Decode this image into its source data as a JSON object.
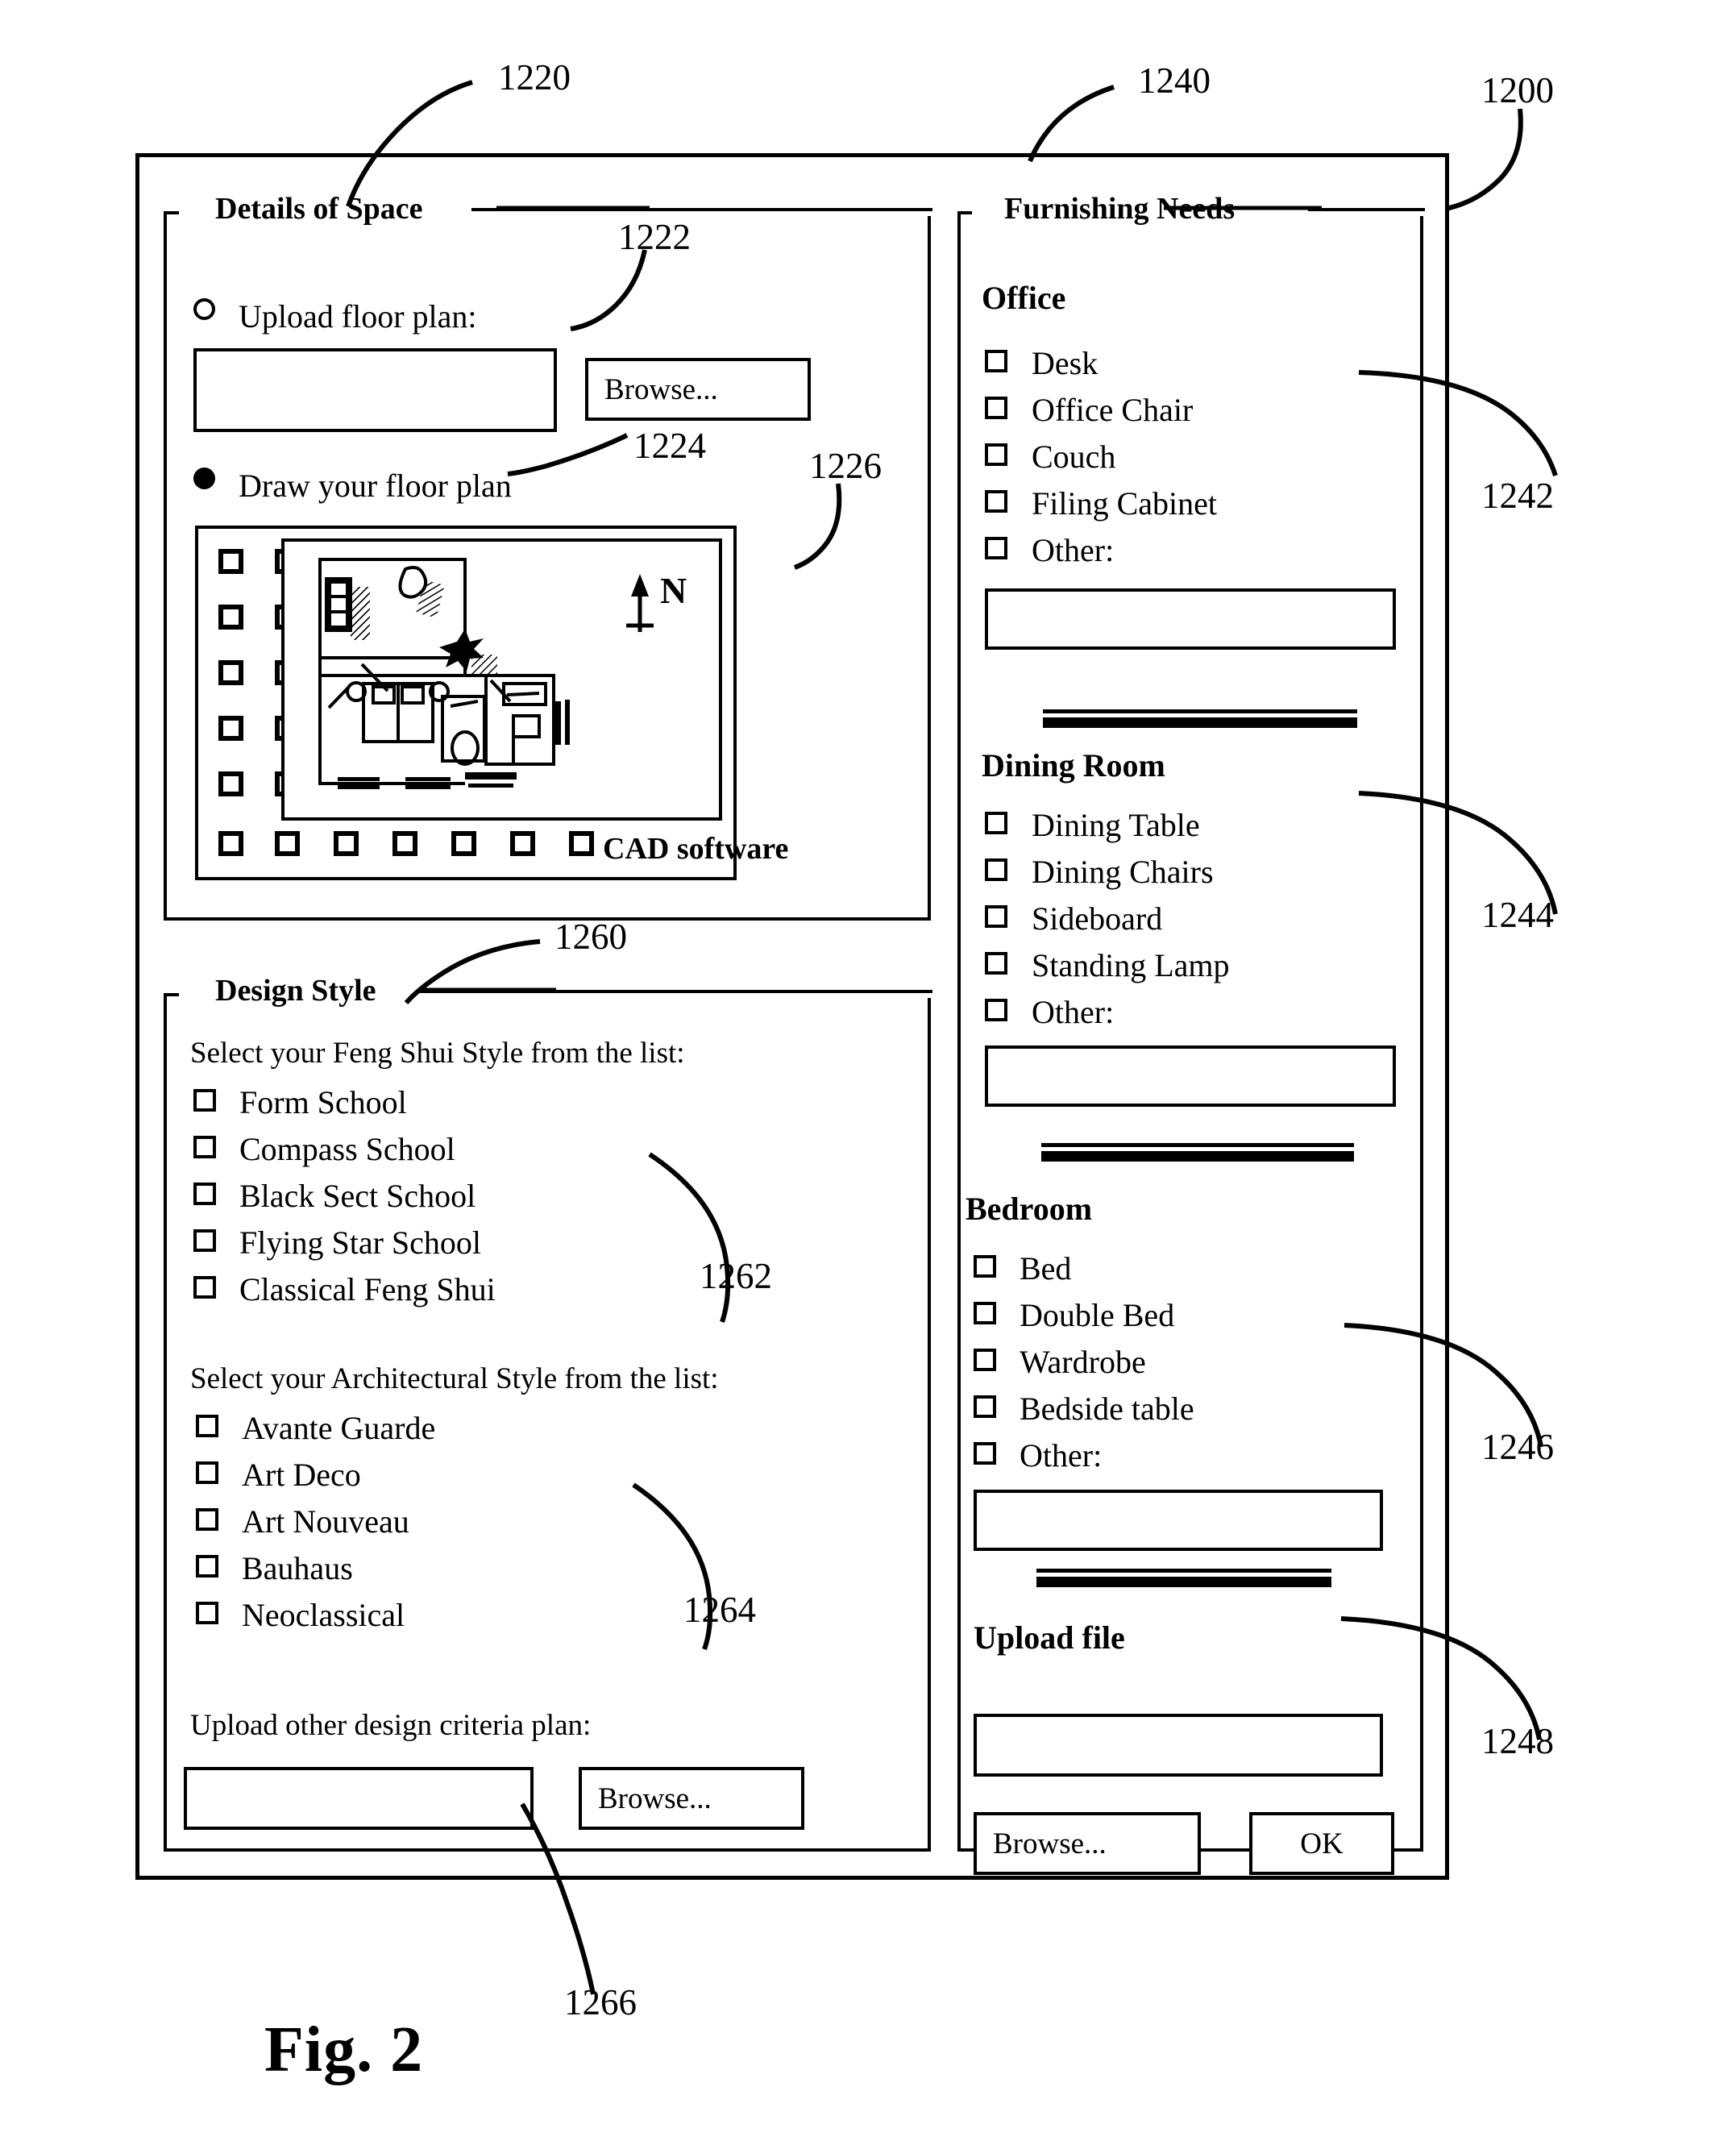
{
  "figure": {
    "label": "Fig. 2",
    "ref_main": "1200"
  },
  "details_of_space": {
    "title": "Details of Space",
    "ref": "1220",
    "upload_option": {
      "label": "Upload floor plan:",
      "ref": "1222",
      "selected": false,
      "input_value": "",
      "browse_label": "Browse..."
    },
    "draw_option": {
      "label": "Draw your floor plan",
      "ref": "1224",
      "selected": true
    },
    "cad": {
      "ref": "1226",
      "software_label": "CAD software",
      "north_label": "N",
      "left_tool_rows": 6,
      "left_tool_cols": 2,
      "bottom_tool_count": 7
    }
  },
  "design_style": {
    "title": "Design Style",
    "ref": "1260",
    "feng_shui": {
      "prompt": "Select your Feng Shui Style from the list:",
      "ref": "1262",
      "options": [
        "Form School",
        "Compass School",
        "Black Sect School",
        "Flying Star School",
        "Classical Feng Shui"
      ]
    },
    "architectural": {
      "prompt": "Select your Architectural Style from the list:",
      "ref": "1264",
      "options": [
        "Avante Guarde",
        "Art Deco",
        "Art Nouveau",
        "Bauhaus",
        "Neoclassical"
      ]
    },
    "upload_other": {
      "label": "Upload other design criteria plan:",
      "ref": "1266",
      "input_value": "",
      "browse_label": "Browse..."
    }
  },
  "furnishing_needs": {
    "title": "Furnishing Needs",
    "ref": "1240",
    "groups": [
      {
        "heading": "Office",
        "ref": "1242",
        "options": [
          "Desk",
          "Office Chair",
          "Couch",
          "Filing Cabinet",
          "Other:"
        ],
        "other_value": ""
      },
      {
        "heading": "Dining Room",
        "ref": "1244",
        "options": [
          "Dining Table",
          "Dining Chairs",
          "Sideboard",
          "Standing Lamp",
          "Other:"
        ],
        "other_value": ""
      },
      {
        "heading": "Bedroom",
        "ref": "1246",
        "options": [
          "Bed",
          "Double Bed",
          "Wardrobe",
          "Bedside table",
          "Other:"
        ],
        "other_value": ""
      }
    ],
    "upload_file": {
      "heading": "Upload file",
      "ref": "1248",
      "input_value": "",
      "browse_label": "Browse...",
      "ok_label": "OK"
    }
  }
}
